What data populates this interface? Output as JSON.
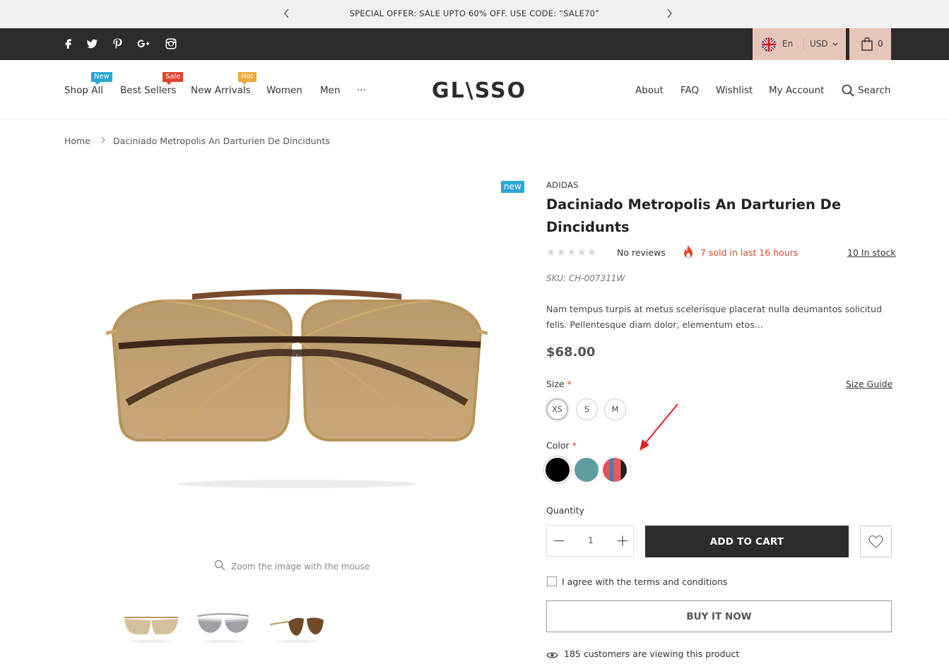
{
  "announcement": {
    "text": "SPECIAL OFFER: SALE UPTO 60% OFF. USE CODE: “SALE70”"
  },
  "topbar": {
    "lang": "En",
    "currency": "USD",
    "cart_count": "0"
  },
  "nav": {
    "left": [
      {
        "label": "Shop All",
        "badge": "New",
        "badge_color": "#29a8d4"
      },
      {
        "label": "Best Sellers",
        "badge": "Sale",
        "badge_color": "#e0452c"
      },
      {
        "label": "New Arrivals",
        "badge": "Hot",
        "badge_color": "#f3a93a"
      },
      {
        "label": "Women"
      },
      {
        "label": "Men"
      },
      {
        "label": "..."
      }
    ],
    "logo": "GL\\SSO",
    "right": [
      {
        "label": "About"
      },
      {
        "label": "FAQ"
      },
      {
        "label": "Wishlist"
      },
      {
        "label": "My Account"
      },
      {
        "label": "Search"
      }
    ]
  },
  "breadcrumb": {
    "home": "Home",
    "current": "Daciniado Metropolis An Darturien De Dincidunts"
  },
  "gallery": {
    "badge": "new",
    "zoom_hint": "Zoom the image with the mouse"
  },
  "product": {
    "brand": "ADIDAS",
    "title": "Daciniado Metropolis An Darturien De Dincidunts",
    "rating": 0,
    "reviews": "No reviews",
    "sold": "7 sold in last 16 hours",
    "stock": "10 In stock",
    "sku": "SKU: CH-007311W",
    "description": "Nam tempus turpis at metus scelerisque placerat nulla deumantos solicitud felis. Pellentesque diam dolor, elementum etos...",
    "price": "$68.00",
    "size_label": "Size",
    "size_guide": "Size Guide",
    "sizes": [
      "XS",
      "S",
      "M"
    ],
    "selected_size": "XS",
    "color_label": "Color",
    "colors": [
      "#000000",
      "#5f9ea0",
      "#e8505b"
    ],
    "quantity_label": "Quantity",
    "quantity": "1",
    "add_to_cart": "ADD TO CART",
    "terms": "I agree with the terms and conditions",
    "buy_now": "BUY IT NOW",
    "viewing": "185 customers are viewing this product"
  },
  "colors": {
    "topbar_bg": "#2a2c2e",
    "accent_peach": "#e6c6b8",
    "sale_red": "#d9472b",
    "new_blue": "#29a8d4"
  }
}
